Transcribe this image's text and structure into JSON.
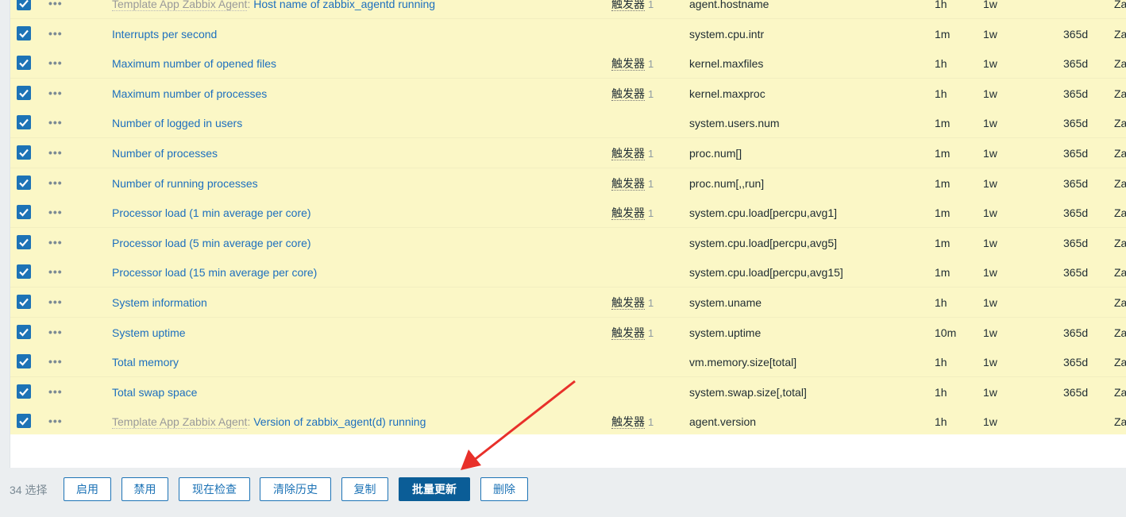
{
  "items": [
    {
      "template": "Template App Zabbix Agent",
      "name": "Host name of zabbix_agentd running",
      "trigger": "触发器",
      "trigger_count": "1",
      "key": "agent.hostname",
      "interval": "1h",
      "history": "1w",
      "trends": "",
      "type": "Za"
    },
    {
      "template": "",
      "name": "Interrupts per second",
      "trigger": "",
      "trigger_count": "",
      "key": "system.cpu.intr",
      "interval": "1m",
      "history": "1w",
      "trends": "365d",
      "type": "Za"
    },
    {
      "template": "",
      "name": "Maximum number of opened files",
      "trigger": "触发器",
      "trigger_count": "1",
      "key": "kernel.maxfiles",
      "interval": "1h",
      "history": "1w",
      "trends": "365d",
      "type": "Za"
    },
    {
      "template": "",
      "name": "Maximum number of processes",
      "trigger": "触发器",
      "trigger_count": "1",
      "key": "kernel.maxproc",
      "interval": "1h",
      "history": "1w",
      "trends": "365d",
      "type": "Za"
    },
    {
      "template": "",
      "name": "Number of logged in users",
      "trigger": "",
      "trigger_count": "",
      "key": "system.users.num",
      "interval": "1m",
      "history": "1w",
      "trends": "365d",
      "type": "Za"
    },
    {
      "template": "",
      "name": "Number of processes",
      "trigger": "触发器",
      "trigger_count": "1",
      "key": "proc.num[]",
      "interval": "1m",
      "history": "1w",
      "trends": "365d",
      "type": "Za"
    },
    {
      "template": "",
      "name": "Number of running processes",
      "trigger": "触发器",
      "trigger_count": "1",
      "key": "proc.num[,,run]",
      "interval": "1m",
      "history": "1w",
      "trends": "365d",
      "type": "Za"
    },
    {
      "template": "",
      "name": "Processor load (1 min average per core)",
      "trigger": "触发器",
      "trigger_count": "1",
      "key": "system.cpu.load[percpu,avg1]",
      "interval": "1m",
      "history": "1w",
      "trends": "365d",
      "type": "Za"
    },
    {
      "template": "",
      "name": "Processor load (5 min average per core)",
      "trigger": "",
      "trigger_count": "",
      "key": "system.cpu.load[percpu,avg5]",
      "interval": "1m",
      "history": "1w",
      "trends": "365d",
      "type": "Za"
    },
    {
      "template": "",
      "name": "Processor load (15 min average per core)",
      "trigger": "",
      "trigger_count": "",
      "key": "system.cpu.load[percpu,avg15]",
      "interval": "1m",
      "history": "1w",
      "trends": "365d",
      "type": "Za"
    },
    {
      "template": "",
      "name": "System information",
      "trigger": "触发器",
      "trigger_count": "1",
      "key": "system.uname",
      "interval": "1h",
      "history": "1w",
      "trends": "",
      "type": "Za"
    },
    {
      "template": "",
      "name": "System uptime",
      "trigger": "触发器",
      "trigger_count": "1",
      "key": "system.uptime",
      "interval": "10m",
      "history": "1w",
      "trends": "365d",
      "type": "Za"
    },
    {
      "template": "",
      "name": "Total memory",
      "trigger": "",
      "trigger_count": "",
      "key": "vm.memory.size[total]",
      "interval": "1h",
      "history": "1w",
      "trends": "365d",
      "type": "Za"
    },
    {
      "template": "",
      "name": "Total swap space",
      "trigger": "",
      "trigger_count": "",
      "key": "system.swap.size[,total]",
      "interval": "1h",
      "history": "1w",
      "trends": "365d",
      "type": "Za"
    },
    {
      "template": "Template App Zabbix Agent",
      "name": "Version of zabbix_agent(d) running",
      "trigger": "触发器",
      "trigger_count": "1",
      "key": "agent.version",
      "interval": "1h",
      "history": "1w",
      "trends": "",
      "type": "Za"
    }
  ],
  "row_menu_icon": "ellipsis-icon",
  "checkbox_icon": "checkmark-icon",
  "footer": {
    "selected_count": "34 选择",
    "buttons": {
      "enable": "启用",
      "disable": "禁用",
      "check_now": "现在检查",
      "clear_history": "清除历史",
      "copy": "复制",
      "mass_update": "批量更新",
      "delete": "删除"
    }
  },
  "annotation": {
    "color": "#e8302a",
    "points_to": "mass_update"
  },
  "colors": {
    "link": "#1d6fbe",
    "row_selected": "#fbf7c6",
    "primary_button": "#0b5d97",
    "checkbox": "#1d73b6"
  }
}
